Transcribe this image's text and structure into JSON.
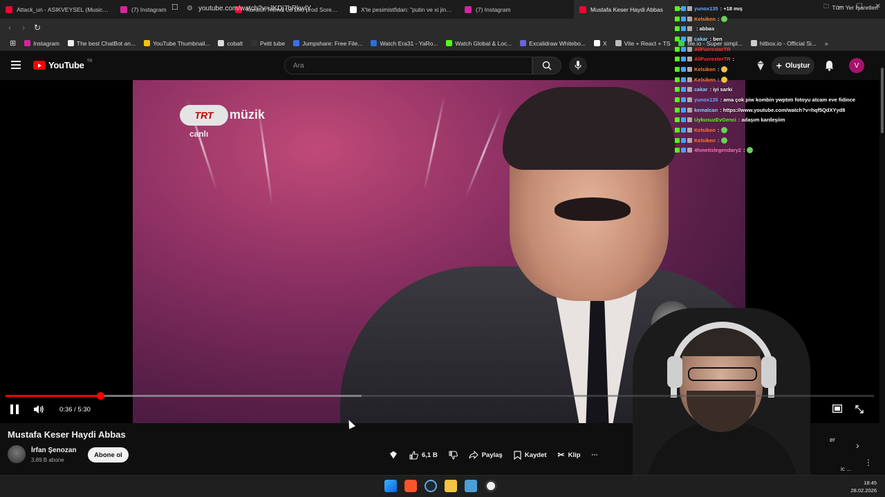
{
  "browser": {
    "tabs": [
      {
        "title": "Attack_un - ASIKVEYSEL (Music Vide",
        "color": "#ff0033"
      },
      {
        "title": "(7) Instagram",
        "color": "#d6249f"
      },
      {
        "title": "Kurdish Remix Lo Dilo prod Sore Pro",
        "color": "#ff0033"
      },
      {
        "title": "X'te pesimistfidan: \"putin ve xi jinpin",
        "color": "#ffffff"
      },
      {
        "title": "(7) Instagram",
        "color": "#d6249f"
      },
      {
        "title": "Mustafa Keser Haydi Abbas",
        "color": "#ff0033",
        "active": true
      }
    ],
    "url": "youtube.com/watch?v=JKDj7bRkwlY",
    "bookmarks": [
      {
        "label": "Instagram",
        "color": "#d6249f"
      },
      {
        "label": "The best ChatBot an...",
        "color": "#eeeeee"
      },
      {
        "label": "YouTube Thumbnail...",
        "color": "#f4c20d"
      },
      {
        "label": "cobalt",
        "color": "#dddddd"
      },
      {
        "label": "Petit tube",
        "color": "#333333"
      },
      {
        "label": "Jumpshare: Free File...",
        "color": "#3b6ee8"
      },
      {
        "label": "Watch Era31 - YaRo...",
        "color": "#2a6fdb"
      },
      {
        "label": "Watch Global & Loc...",
        "color": "#53fc18"
      },
      {
        "label": "Excalidraw Whitebo...",
        "color": "#6965db"
      },
      {
        "label": "X",
        "color": "#ffffff"
      },
      {
        "label": "Vite + React + TS",
        "color": "#bbbbbb"
      },
      {
        "label": "file.io - Super simpl...",
        "color": "#44cc44"
      },
      {
        "label": "hitbox.io - Official Si...",
        "color": "#cccccc"
      }
    ],
    "bookmarks_overflow": "»",
    "all_bookmarks": "Tüm Yer İşaretleri"
  },
  "youtube": {
    "logo_text": "YouTube",
    "logo_country": "TR",
    "search_placeholder": "Ara",
    "create_label": "Oluştur",
    "avatar_letter": "V"
  },
  "video": {
    "channel_logo_pill": "TRT",
    "channel_logo_word": "müzik",
    "channel_logo_live": "canlı",
    "current_time": "0:36",
    "duration": "5:30",
    "timecode": "0:36 / 5:30",
    "progress_fraction": 0.109,
    "buffered_fraction": 0.41,
    "title": "Mustafa Keser Haydi Abbas",
    "channel_name": "İrfan Şenozan",
    "subscribers": "3,89 B abone",
    "subscribe_label": "Abone ol",
    "likes": "6,1 B",
    "share_label": "Paylaş",
    "save_label": "Kaydet",
    "clip_label": "Klip",
    "more_label": "···"
  },
  "sidebar_peek": {
    "partial_text_1": "er",
    "partial_text_2": "ic ..."
  },
  "chat": [
    {
      "user": "yunox135",
      "text": ": +18 mış",
      "color": "#6aa7ff"
    },
    {
      "user": "Kelsiken",
      "text": ":",
      "color": "#ff7a2e",
      "emote": "g"
    },
    {
      "user": "",
      "text": ": abbas",
      "color": "#ff3030"
    },
    {
      "user": "cakar",
      "text": ": ben",
      "color": "#7fd0ff"
    },
    {
      "user": "AllFurrexterTR",
      "text": "",
      "color": "#ff3030"
    },
    {
      "user": "AllFurrexterTR",
      "text": ":",
      "color": "#ff3030"
    },
    {
      "user": "Kelsiken",
      "text": ":",
      "color": "#ff7a2e",
      "emote": "y"
    },
    {
      "user": "Kelsiken",
      "text": ":",
      "color": "#ff7a2e",
      "emote": "y"
    },
    {
      "user": "cakar",
      "text": ": iyi sarki",
      "color": "#7fd0ff"
    },
    {
      "user": "yunox135",
      "text": ": ama çok piw kombin ywptım fotoyu atcam eve fidince",
      "color": "#6aa7ff"
    },
    {
      "user": "kemalcan",
      "text": ": https://www.youtube.com/watch?v=hqf5QdXYyd8",
      "color": "#7fd0ff"
    },
    {
      "user": "UykusuzEvGenci",
      "text": ": adaşım kardeşiim",
      "color": "#53fc18"
    },
    {
      "user": "Kelsiken",
      "text": ":",
      "color": "#ff7a2e",
      "emote": "g"
    },
    {
      "user": "Kelsiken",
      "text": ":",
      "color": "#ff7a2e",
      "emote": "g"
    },
    {
      "user": "4hmetislegendary2",
      "text": ":",
      "color": "#ff6fb3",
      "emote": "g"
    }
  ],
  "clock": {
    "time": "18:45",
    "date": "28.02.2026"
  },
  "colors": {
    "accent": "#ff0000",
    "kick_green": "#53fc18"
  }
}
